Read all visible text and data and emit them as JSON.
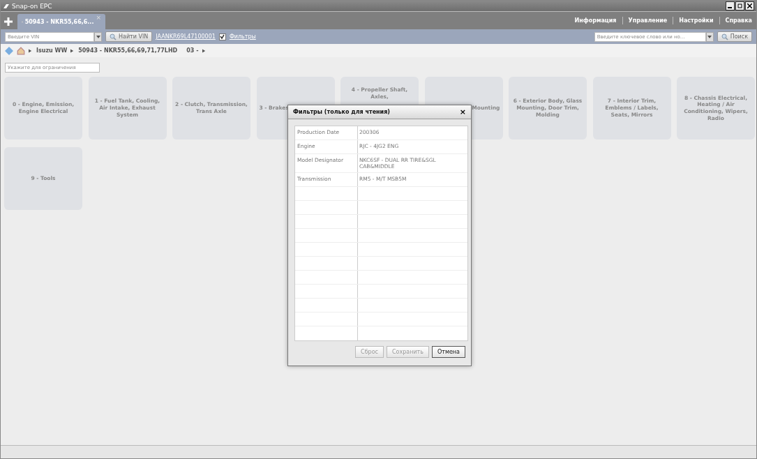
{
  "window": {
    "title": "Snap-on EPC"
  },
  "tabs": [
    {
      "label": "50943 - NKR55,66,6...",
      "selected": true,
      "close": "×"
    }
  ],
  "top_menu": [
    "Информация",
    "Управление",
    "Настройки",
    "Справка"
  ],
  "toolbar": {
    "vin_field": {
      "placeholder": "Введите VIN"
    },
    "find_vin": "Найти VIN",
    "vin_link": "JAANKR69L47100001",
    "filters": {
      "label": "Фильтры",
      "checked": true
    },
    "search_field": {
      "placeholder": "Введите ключевое слово или но..."
    },
    "search": "Поиск"
  },
  "breadcrumb": [
    "Isuzu WW",
    "50943 - NKR55,66,69,71,77LHD",
    "03 -"
  ],
  "filter_field": {
    "placeholder": "Укажите для ограничения"
  },
  "tiles": [
    {
      "label": "0 - Engine, Emission, Engine Electrical"
    },
    {
      "label": "1 - Fuel Tank, Cooling, Air Intake, Exhaust System"
    },
    {
      "label": "2 - Clutch, Transmission, Trans Axle"
    },
    {
      "label": "3 - Brakes"
    },
    {
      "label": "4 - Propeller Shaft, Axles,"
    },
    {
      "label": "Mounting"
    },
    {
      "label": "6 - Exterior Body, Glass Mounting, Door Trim, Molding"
    },
    {
      "label": "7 - Interior Trim, Emblems / Labels, Seats, Mirrors"
    },
    {
      "label": "8 - Chassis Electrical, Heating / Air Conditioning, Wipers, Radio"
    },
    {
      "label": "9 - Tools"
    }
  ],
  "dialog": {
    "title": "Фильтры (только для чтения)",
    "close": "×",
    "rows": [
      {
        "name": "Production Date",
        "value": "200306"
      },
      {
        "name": "Engine",
        "value": "RJC -  4JG2 ENG"
      },
      {
        "name": "Model Designator",
        "value": "NKC6SF -  DUAL RR TIRE&SGL CAB&MIDDLE"
      },
      {
        "name": "Transmission",
        "value": "RM5 -  M/T MSB5M"
      }
    ],
    "buttons": [
      {
        "label": "Сброс",
        "disabled": true
      },
      {
        "label": "Сохранить",
        "disabled": true
      },
      {
        "label": "Отмена",
        "disabled": false
      }
    ]
  }
}
